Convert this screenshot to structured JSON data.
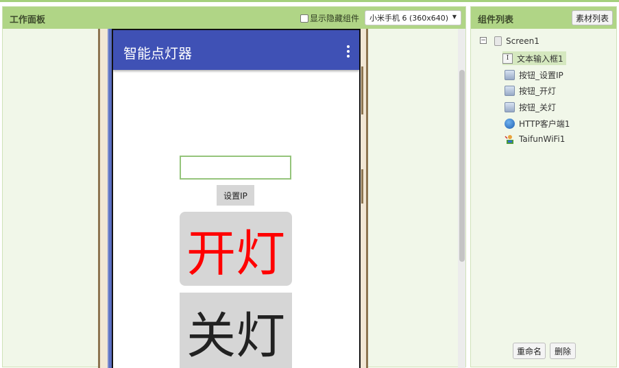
{
  "viewer": {
    "title": "工作面板",
    "show_hidden_label": "显示隐藏组件",
    "device_select": "小米手机 6 (360x640)"
  },
  "phone": {
    "app_title": "智能点灯器",
    "ip_input_value": "",
    "set_ip_label": "设置IP",
    "on_label": "开灯",
    "on_color": "#ff0000",
    "off_label": "关灯",
    "appbar_color": "#3f51b5"
  },
  "components": {
    "title": "组件列表",
    "media_button": "素材列表",
    "root": "Screen1",
    "items": [
      {
        "label": "文本输入框1",
        "icon": "textbox-icon"
      },
      {
        "label": "按钮_设置IP",
        "icon": "button-icon"
      },
      {
        "label": "按钮_开灯",
        "icon": "button-icon"
      },
      {
        "label": "按钮_关灯",
        "icon": "button-icon"
      },
      {
        "label": "HTTP客户端1",
        "icon": "web-icon"
      },
      {
        "label": "TaifunWiFi1",
        "icon": "wifi-extension-icon"
      }
    ],
    "rename_button": "重命名",
    "delete_button": "删除"
  }
}
